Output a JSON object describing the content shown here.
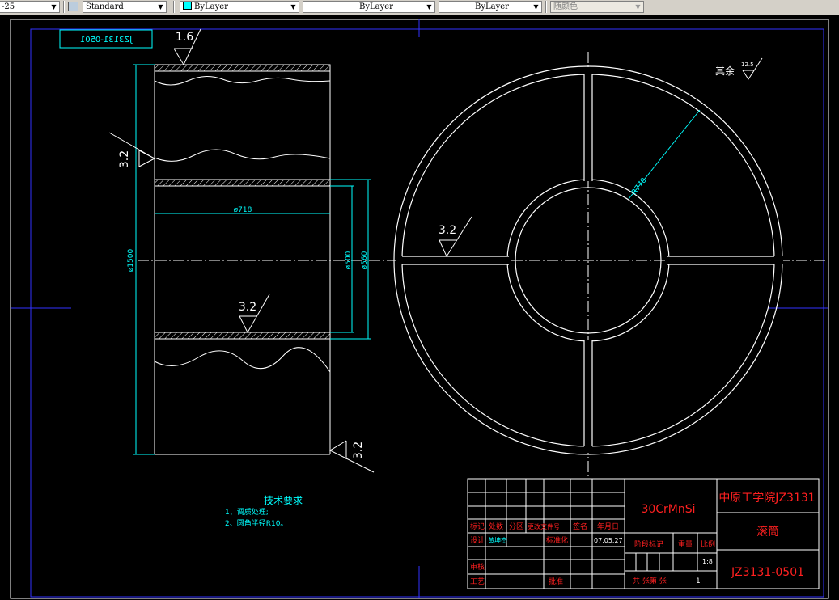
{
  "toolbar": {
    "dimstyle_value": "-25",
    "textstyle_value": "Standard",
    "layer_value": "ByLayer",
    "linetype_value": "ByLayer",
    "lineweight_value": "ByLayer",
    "plotstyle_value": "随颜色",
    "layer_color": "#00ffff"
  },
  "drawing": {
    "ref_id_mirrored": "JZ3131-0501",
    "roughness": {
      "top": "1.6",
      "left": "3.2",
      "middle": "3.2",
      "bottom_right": "3.2",
      "circle": "3.2",
      "other_prefix": "其余",
      "other_value": "12.5"
    },
    "dims": {
      "outer_dia": "ø1500",
      "bore": "ø718",
      "dia_500": "ø500",
      "dia_560": "ø560",
      "radius": "R770"
    },
    "tech_req": {
      "title": "技术要求",
      "line1": "1、调质处理;",
      "line2": "2、圆角半径R10。"
    },
    "title_block": {
      "material": "30CrMnSi",
      "school": "中原工学院JZ3131",
      "part_name": "滚筒",
      "drawing_no": "JZ3131-0501",
      "h_mark": "标记",
      "h_count": "处数",
      "h_zone": "分区",
      "h_doc": "更改文件号",
      "h_sign": "签名",
      "h_date": "年月日",
      "l_design": "设计",
      "designer": "黄坤杰",
      "l_std": "标准化",
      "date": "07.05.27",
      "l_stage": "阶段标记",
      "l_weight": "重量",
      "l_scale": "比例",
      "scale": "1:8",
      "l_review": "审核",
      "l_process": "工艺",
      "l_approve": "批准",
      "sheets_text": "共  张第  张",
      "sheet_no": "1"
    }
  }
}
